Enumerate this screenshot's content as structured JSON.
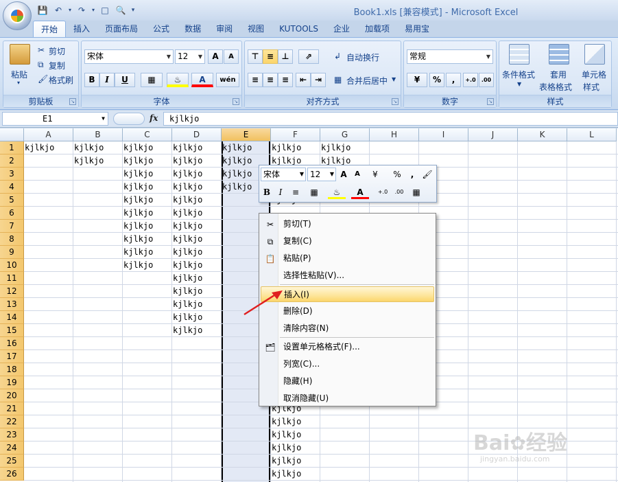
{
  "window": {
    "title": "Book1.xls  [兼容模式] - Microsoft Excel"
  },
  "tabs": [
    "开始",
    "插入",
    "页面布局",
    "公式",
    "数据",
    "审阅",
    "视图",
    "KUTOOLS",
    "企业",
    "加载项",
    "易用宝"
  ],
  "ribbon": {
    "clipboard": {
      "label": "剪贴板",
      "paste": "粘贴",
      "cut": "剪切",
      "copy": "复制",
      "format_painter": "格式刷"
    },
    "font": {
      "label": "字体",
      "name": "宋体",
      "size": "12",
      "grow": "A",
      "shrink": "A",
      "bold": "B",
      "italic": "I",
      "underline": "U",
      "phonetic": "wén"
    },
    "alignment": {
      "label": "对齐方式",
      "wrap": "自动换行",
      "merge": "合并后居中"
    },
    "number": {
      "label": "数字",
      "format": "常规",
      "percent": "%",
      "comma": ",",
      "inc_decimal": "+.0 .00",
      "dec_decimal": ".00 +.0"
    },
    "styles": {
      "label": "样式",
      "conditional": "条件格式",
      "table": "套用表格格式",
      "cell": "单元格样式"
    },
    "table_line1": "套用",
    "table_line2": "表格格式",
    "cell_line1": "单元格",
    "cell_line2": "样式"
  },
  "formula_bar": {
    "name_box": "E1",
    "fx": "fx",
    "content": "kjlkjo"
  },
  "sheet": {
    "columns": [
      "A",
      "B",
      "C",
      "D",
      "E",
      "F",
      "G",
      "H",
      "I",
      "J",
      "K",
      "L"
    ],
    "selected_column": "E",
    "rows": [
      "1",
      "2",
      "3",
      "4",
      "5",
      "6",
      "7",
      "8",
      "9",
      "10",
      "11",
      "12",
      "13",
      "14",
      "15",
      "16",
      "17",
      "18",
      "19",
      "20",
      "21",
      "22",
      "23",
      "24",
      "25",
      "26"
    ],
    "cell_text": "kjlkjo",
    "filled": {
      "A": [
        1
      ],
      "B": [
        1,
        2
      ],
      "C": [
        1,
        2,
        3,
        4,
        5,
        6,
        7,
        8,
        9,
        10
      ],
      "D": [
        1,
        2,
        3,
        4,
        5,
        6,
        7,
        8,
        9,
        10,
        11,
        12,
        13,
        14,
        15
      ],
      "E": [
        1,
        2,
        3,
        4
      ],
      "F": [
        1,
        2,
        3,
        4,
        5,
        21,
        22,
        23,
        24,
        25,
        26
      ],
      "G": [
        1,
        2
      ]
    }
  },
  "mini_toolbar": {
    "font": "宋体",
    "size": "12",
    "bold": "B",
    "italic": "I",
    "percent": "%",
    "comma": ","
  },
  "context_menu": {
    "items": [
      {
        "label": "剪切(T)",
        "icon": "scissors-icon"
      },
      {
        "label": "复制(C)",
        "icon": "copy-icon"
      },
      {
        "label": "粘贴(P)",
        "icon": "paste-icon"
      },
      {
        "label": "选择性粘贴(V)...",
        "icon": ""
      },
      {
        "label": "插入(I)",
        "icon": "",
        "highlighted": true
      },
      {
        "label": "删除(D)",
        "icon": ""
      },
      {
        "label": "清除内容(N)",
        "icon": ""
      },
      {
        "label": "设置单元格格式(F)...",
        "icon": "format-cells-icon"
      },
      {
        "label": "列宽(C)...",
        "icon": ""
      },
      {
        "label": "隐藏(H)",
        "icon": ""
      },
      {
        "label": "取消隐藏(U)",
        "icon": ""
      }
    ]
  },
  "watermark": {
    "brand": "Bai",
    "brand2": "经验",
    "url": "jingyan.baidu.com"
  },
  "colors": {
    "accent": "#15428b",
    "selected_header": "#f3c76e",
    "highlight": "#fde59a",
    "annotation_arrow": "#e02020"
  }
}
